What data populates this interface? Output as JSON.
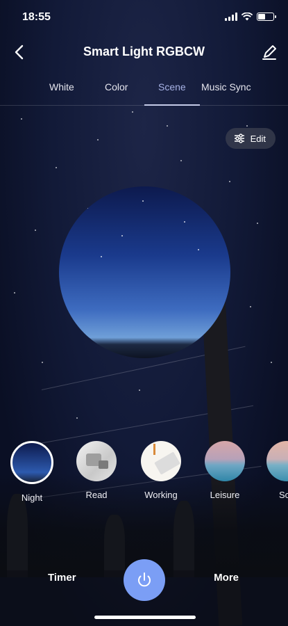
{
  "status_bar": {
    "time": "18:55"
  },
  "header": {
    "title": "Smart Light RGBCW"
  },
  "tabs": [
    {
      "label": "White",
      "active": false
    },
    {
      "label": "Color",
      "active": false
    },
    {
      "label": "Scene",
      "active": true
    },
    {
      "label": "Music Sync",
      "active": false
    }
  ],
  "edit_button": {
    "label": "Edit",
    "icon": "sliders-icon"
  },
  "scenes": [
    {
      "label": "Night",
      "selected": true,
      "thumb": "night"
    },
    {
      "label": "Read",
      "selected": false,
      "thumb": "read"
    },
    {
      "label": "Working",
      "selected": false,
      "thumb": "working"
    },
    {
      "label": "Leisure",
      "selected": false,
      "thumb": "leisure"
    },
    {
      "label": "Sc",
      "selected": false,
      "thumb": "fifth"
    }
  ],
  "bottom": {
    "timer_label": "Timer",
    "more_label": "More"
  },
  "colors": {
    "accent": "#7b9ef5",
    "active_tab": "#a8b3e6",
    "background": "#0b1026"
  }
}
